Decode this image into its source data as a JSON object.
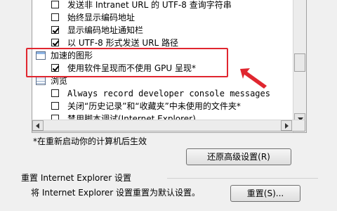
{
  "options": [
    {
      "label": "发送非 Intranet URL 的 UTF-8 查询字符串",
      "checked": false
    },
    {
      "label": "始终显示编码地址",
      "checked": false
    },
    {
      "label": "显示编码地址通知栏",
      "checked": true
    },
    {
      "label": "以 UTF-8 形式发送 URL 路径",
      "checked": true
    }
  ],
  "categories": {
    "accelerated_graphics": {
      "label": "加速的图形",
      "options": [
        {
          "label": "使用软件呈现而不使用 GPU 呈现*",
          "checked": true
        }
      ]
    },
    "browsing": {
      "label": "浏览",
      "options": [
        {
          "label": "Always record developer console messages",
          "checked": false
        },
        {
          "label": "关闭“历史记录”和“收藏夹”中未使用的文件夹*",
          "checked": false
        },
        {
          "label": "禁用脚本调试(Internet Explorer)",
          "checked": false
        }
      ]
    }
  },
  "restart_note": "*在重新启动你的计算机后生效",
  "restore_advanced_button": "还原高级设置(R)",
  "reset_group": {
    "title": "重置 Internet Explorer 设置",
    "description": "将 Internet Explorer 设置重置为默认设置。",
    "reset_button": "重置(S)..."
  },
  "colors": {
    "highlight": "#e0262f"
  }
}
